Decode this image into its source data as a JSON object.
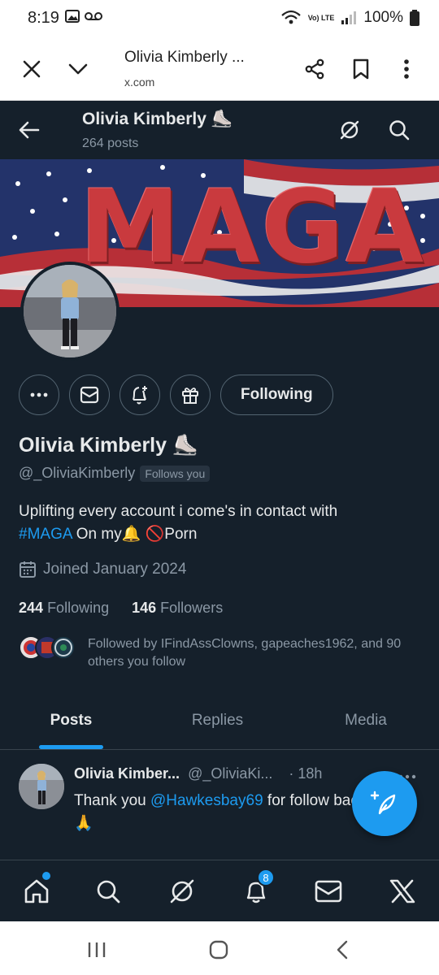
{
  "status_bar": {
    "time": "8:19",
    "battery": "100%",
    "network": "Vo) LTE"
  },
  "browser": {
    "page_title": "Olivia Kimberly ...",
    "url": "x.com"
  },
  "header": {
    "name": "Olivia Kimberly ⛸️",
    "post_count": "264 posts"
  },
  "banner": {
    "word": "MAGA"
  },
  "actions": {
    "following_label": "Following"
  },
  "profile": {
    "display_name": "Olivia Kimberly ⛸️",
    "handle": "@_OliviaKimberly",
    "follows_you": "Follows you",
    "bio_line1": "Uplifting every account i come's in contact with",
    "bio_hashtag": "#MAGA",
    "bio_line2_rest": " On my🔔  🚫Porn",
    "joined": "Joined January 2024",
    "following_count": "244",
    "following_label": "Following",
    "followers_count": "146",
    "followers_label": "Followers",
    "followed_by": "Followed by IFindAssClowns, gapeaches1962, and 90 others you follow"
  },
  "tabs": [
    "Posts",
    "Replies",
    "Media"
  ],
  "post": {
    "author": "Olivia Kimber...",
    "handle": "@_OliviaKi...",
    "time": "· 18h",
    "text_pre": "Thank you ",
    "mention": "@Hawkesbay69",
    "text_post": " for follow back 🙏"
  },
  "bottom_nav": {
    "notifications_badge": "8"
  },
  "colors": {
    "background": "#15202b",
    "accent": "#1d9bf0",
    "muted": "#8b98a5",
    "border": "#536471"
  },
  "icons": [
    "back-arrow-icon",
    "grok-icon",
    "search-icon",
    "more-icon",
    "mail-icon",
    "bell-plus-icon",
    "gift-icon",
    "calendar-icon",
    "compose-icon",
    "home-icon",
    "notifications-icon",
    "x-logo-icon"
  ]
}
